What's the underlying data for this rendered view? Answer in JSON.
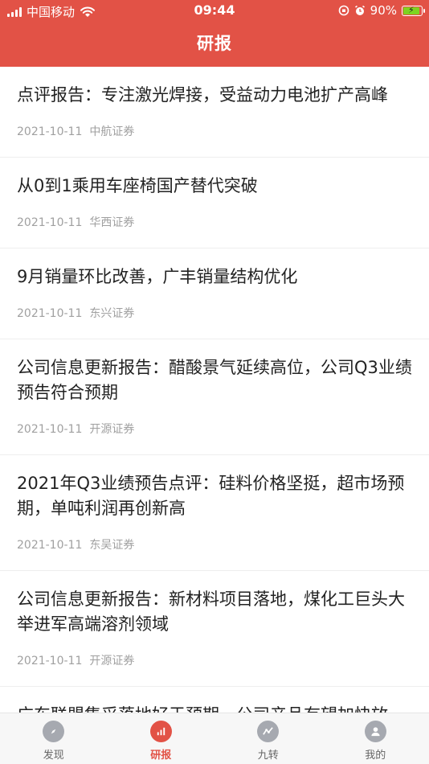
{
  "status": {
    "carrier": "中国移动",
    "time": "09:44",
    "battery": "90%",
    "battery_level": 0.9,
    "battery_color": "#7ed321"
  },
  "header": {
    "title": "研报",
    "bg_color": "#e25246"
  },
  "reports": [
    {
      "title": "点评报告：专注激光焊接，受益动力电池扩产高峰",
      "date": "2021-10-11",
      "source": "中航证券"
    },
    {
      "title": "从0到1乘用车座椅国产替代突破",
      "date": "2021-10-11",
      "source": "华西证券"
    },
    {
      "title": "9月销量环比改善，广丰销量结构优化",
      "date": "2021-10-11",
      "source": "东兴证券"
    },
    {
      "title": "公司信息更新报告：醋酸景气延续高位，公司Q3业绩预告符合预期",
      "date": "2021-10-11",
      "source": "开源证券"
    },
    {
      "title": "2021年Q3业绩预告点评：硅料价格坚挺，超市场预期，单吨利润再创新高",
      "date": "2021-10-11",
      "source": "东吴证券"
    },
    {
      "title": "公司信息更新报告：新材料项目落地，煤化工巨头大举进军高端溶剂领域",
      "date": "2021-10-11",
      "source": "开源证券"
    },
    {
      "title": "广东联盟集采落地好于预期，公司产品有望加快放",
      "date": "",
      "source": ""
    }
  ],
  "tabs": [
    {
      "label": "发现",
      "icon": "compass-icon"
    },
    {
      "label": "研报",
      "icon": "chart-icon",
      "active": true
    },
    {
      "label": "九转",
      "icon": "trend-icon"
    },
    {
      "label": "我的",
      "icon": "person-icon"
    }
  ]
}
